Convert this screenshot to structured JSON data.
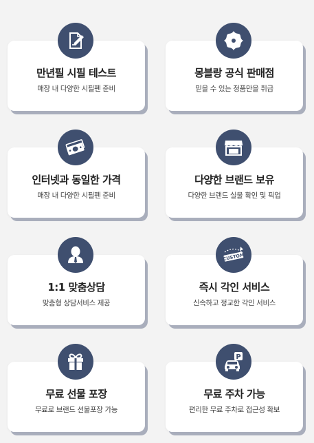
{
  "features": [
    {
      "title": "만년필 시필 테스트",
      "desc": "매장 내 다양한 시필펜 준비",
      "icon": "pen-paper-icon"
    },
    {
      "title": "몽블랑 공식 판매점",
      "desc": "믿을 수 있는 정품만을 취급",
      "icon": "montblanc-star-icon"
    },
    {
      "title": "인터넷과 동일한 가격",
      "desc": "매장 내 다양한 시필펜 준비",
      "icon": "money-bills-icon"
    },
    {
      "title": "다양한 브랜드 보유",
      "desc": "다양한 브랜드 실물 확인 및 픽업",
      "icon": "storefront-icon"
    },
    {
      "title": "1:1 맞춤상담",
      "desc": "맞춤형 상담서비스 제공",
      "icon": "person-bust-icon"
    },
    {
      "title": "즉시 각인 서비스",
      "desc": "신속하고 정교한 각인 서비스",
      "icon": "custom-engraving-icon"
    },
    {
      "title": "무료 선물 포장",
      "desc": "무료로 브랜드 선물포장 가능",
      "icon": "gift-box-icon"
    },
    {
      "title": "무료 주차 가능",
      "desc": "편리한 무료 주차로 접근성 확보",
      "icon": "parking-car-icon"
    }
  ],
  "icon_text": {
    "custom_stamp": "CUSTOM",
    "parking_letter": "P"
  },
  "colors": {
    "badge": "#3f4f6f",
    "card": "#ffffff",
    "shadow": "#a9aebc",
    "background": "#f3f3f3"
  }
}
